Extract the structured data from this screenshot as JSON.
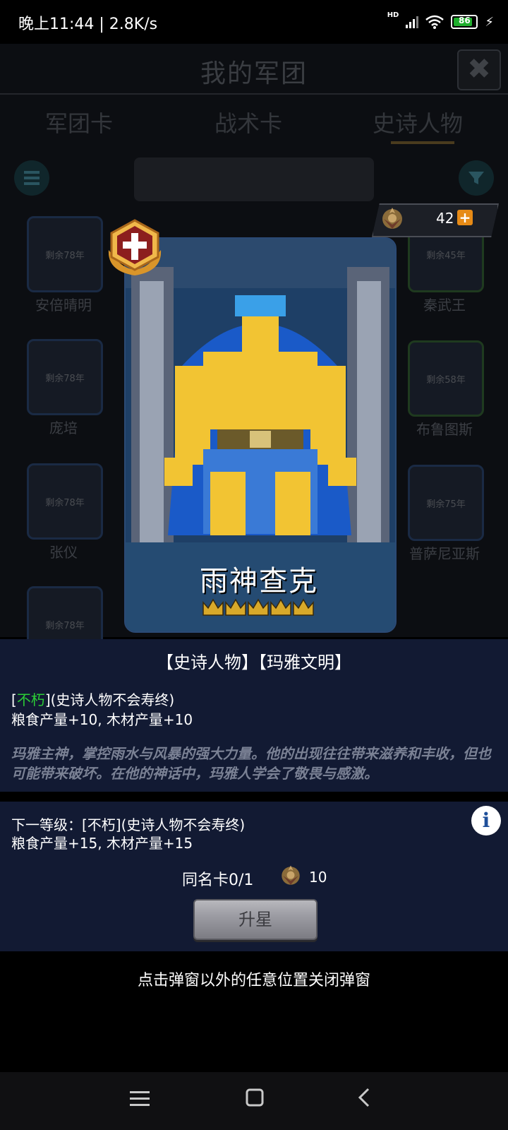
{
  "status_bar": {
    "time": "晚上11:44 | 2.8K/s",
    "battery": "86",
    "network_tag": "HD"
  },
  "background": {
    "title": "我的军团",
    "tabs": [
      "军团卡",
      "战术卡",
      "史诗人物"
    ],
    "cards_left": [
      {
        "remaining": "剩余78年",
        "name": "安倍晴明"
      },
      {
        "remaining": "剩余78年",
        "name": "庞培"
      },
      {
        "remaining": "剩余78年",
        "name": "张仪"
      },
      {
        "remaining": "剩余78年",
        "name": ""
      }
    ],
    "cards_right": [
      {
        "remaining": "剩余45年",
        "name": "秦武王"
      },
      {
        "remaining": "剩余58年",
        "name": "布鲁图斯"
      },
      {
        "remaining": "剩余75年",
        "name": "普萨尼亚斯"
      }
    ]
  },
  "currency": {
    "amount": "42",
    "plus": "+",
    "icon": "medal-icon"
  },
  "hero": {
    "name": "雨神查克",
    "stars": 5,
    "badge_icon": "cross-badge-icon"
  },
  "details": {
    "tags": "【史诗人物】【玛雅文明】",
    "trait_open": "[",
    "trait_name": "不朽",
    "trait_rest": "](史诗人物不会寿终)",
    "stats": "粮食产量+10, 木材产量+10",
    "description": "玛雅主神，掌控雨水与风暴的强大力量。他的出现往往带来滋养和丰收，但也可能带来破坏。在他的神话中，玛雅人学会了敬畏与感激。"
  },
  "next_level": {
    "line1": "下一等级：[不朽](史诗人物不会寿终)",
    "line2": "粮食产量+15, 木材产量+15",
    "dup_label": "同名卡0/1",
    "cost": "10",
    "upgrade_label": "升星"
  },
  "close_hint": "点击弹窗以外的任意位置关闭弹窗",
  "colors": {
    "accent_green": "#2bcc36",
    "panel_bg": "#121a33",
    "gold_plus": "#e68a16"
  }
}
